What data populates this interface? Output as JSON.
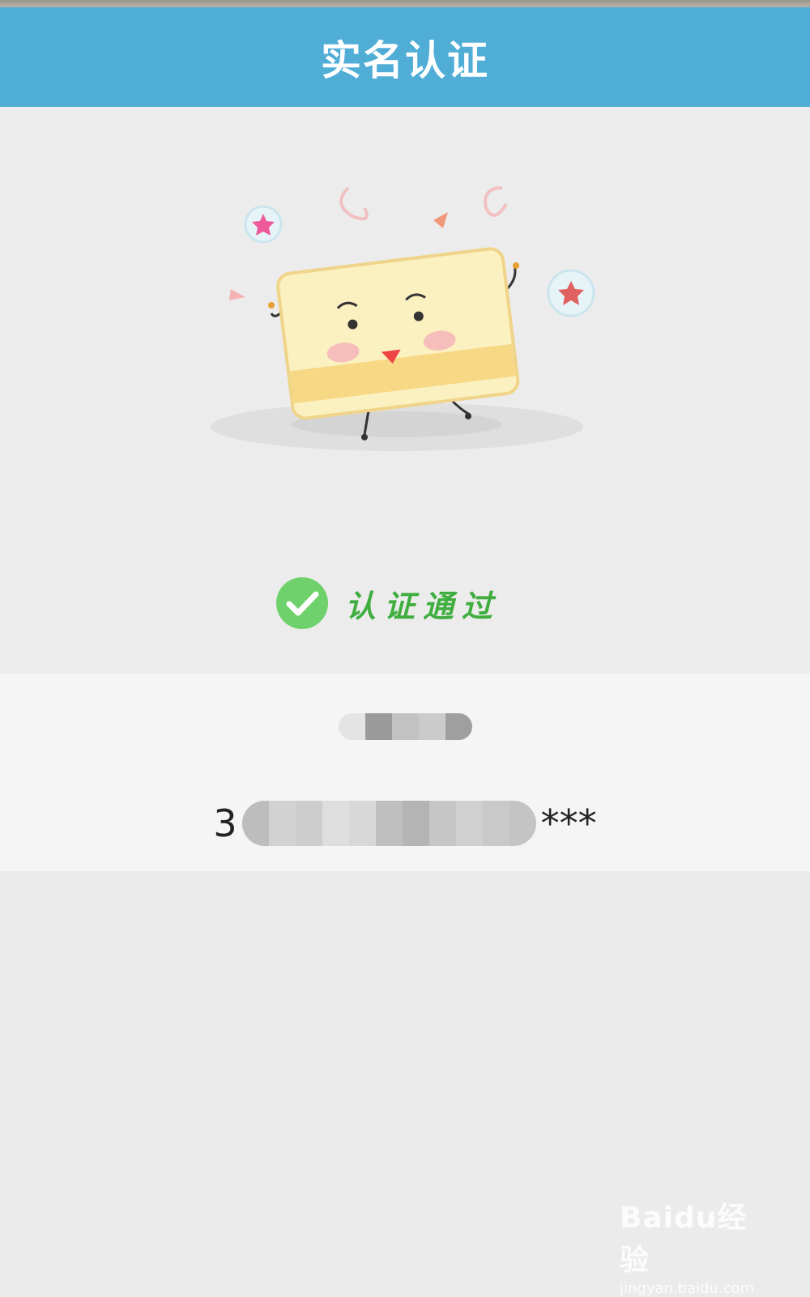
{
  "header": {
    "title": "实名认证"
  },
  "verification": {
    "status_text": "认证通过"
  },
  "info": {
    "id_prefix": "3",
    "id_suffix": "***"
  },
  "watermark": {
    "brand": "Baidu经验",
    "url": "jingyan.baidu.com"
  },
  "colors": {
    "header_bg": "#4fadd6",
    "page_bg": "#ebebeb",
    "info_bg": "#f5f5f5",
    "success_green": "#6fd16b",
    "status_text_green": "#3fae3f"
  },
  "icons": [
    "check-circle-icon",
    "card-mascot-illustration",
    "star-bubble-icon",
    "baidu-paw-icon"
  ]
}
